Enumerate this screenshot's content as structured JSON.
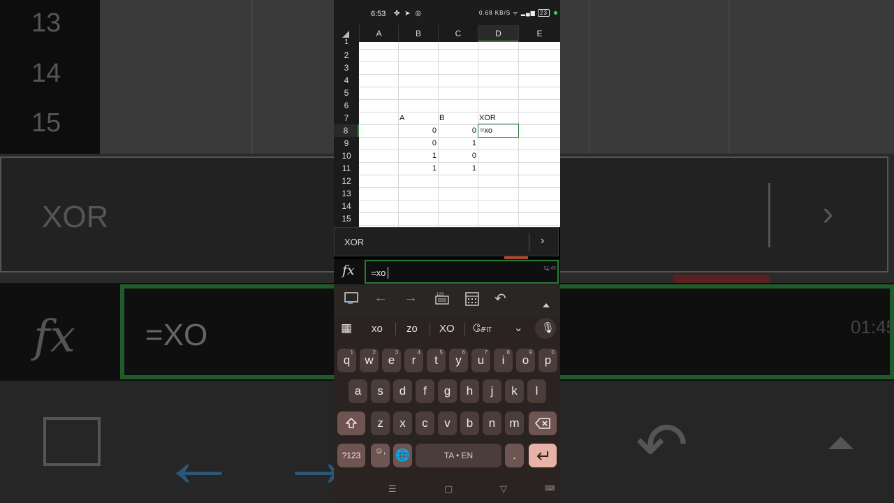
{
  "background": {
    "row_numbers": [
      "13",
      "14",
      "15"
    ],
    "suggestion": "XOR",
    "formula": "=XO",
    "timer": "01:45"
  },
  "status_bar": {
    "time": "6:53",
    "net_speed": "0.68 KB/S",
    "battery": "23"
  },
  "spreadsheet": {
    "columns": [
      "A",
      "B",
      "C",
      "D",
      "E"
    ],
    "selected_column": "D",
    "rows": [
      "1",
      "2",
      "3",
      "4",
      "5",
      "6",
      "7",
      "8",
      "9",
      "10",
      "11",
      "12",
      "13",
      "14",
      "15"
    ],
    "selected_row": "8",
    "cells": {
      "B7": "A",
      "C7": "B",
      "D7": "XOR",
      "B8": "0",
      "C8": "0",
      "D8": "=xo",
      "B9": "0",
      "C9": "1",
      "B10": "1",
      "C10": "0",
      "B11": "1",
      "C11": "1"
    }
  },
  "autocomplete": {
    "suggestion": "XOR",
    "arrow": "›"
  },
  "formula_bar": {
    "fx_label": "fx",
    "value": "=xo",
    "mini_timer": "01:45"
  },
  "toolbar": {
    "icons": [
      "keyboard-toggle-icon",
      "arrow-left-icon",
      "arrow-right-icon",
      "number-keyboard-icon",
      "calculator-icon",
      "undo-icon",
      "expand-up-icon"
    ],
    "num_label": "123"
  },
  "keyboard": {
    "suggestions": [
      "xo",
      "zo",
      "XO",
      "சோ"
    ],
    "row1": [
      {
        "k": "q",
        "n": "1"
      },
      {
        "k": "w",
        "n": "2"
      },
      {
        "k": "e",
        "n": "3"
      },
      {
        "k": "r",
        "n": "4"
      },
      {
        "k": "t",
        "n": "5"
      },
      {
        "k": "y",
        "n": "6"
      },
      {
        "k": "u",
        "n": "7"
      },
      {
        "k": "i",
        "n": "8"
      },
      {
        "k": "o",
        "n": "9"
      },
      {
        "k": "p",
        "n": "0"
      }
    ],
    "row2": [
      "a",
      "s",
      "d",
      "f",
      "g",
      "h",
      "j",
      "k",
      "l"
    ],
    "row3": [
      "z",
      "x",
      "c",
      "v",
      "b",
      "n",
      "m"
    ],
    "symbols_key": "?123",
    "emoji_key": "☺,",
    "space_label": "TA • EN",
    "period_key": "."
  }
}
